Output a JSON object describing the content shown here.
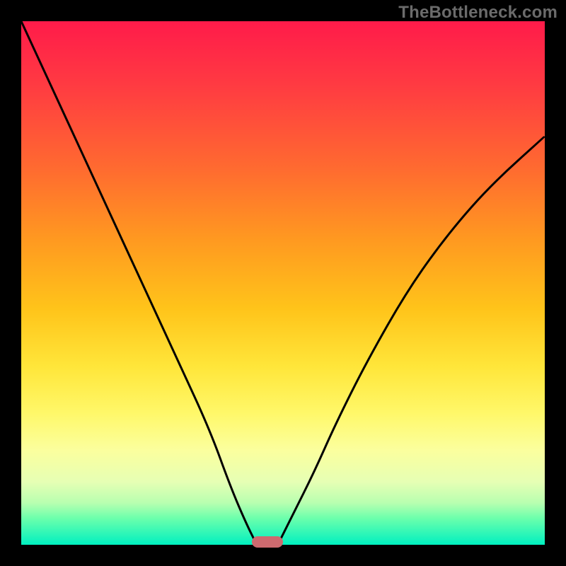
{
  "watermark": "TheBottleneck.com",
  "chart_data": {
    "type": "line",
    "title": "",
    "xlabel": "",
    "ylabel": "",
    "xlim": [
      0,
      100
    ],
    "ylim": [
      0,
      100
    ],
    "grid": false,
    "legend": false,
    "series": [
      {
        "name": "left-curve",
        "x": [
          0,
          6,
          12,
          18,
          24,
          30,
          36,
          40,
          43,
          45
        ],
        "values": [
          100,
          87,
          74,
          61,
          48,
          35,
          22,
          11,
          4,
          0
        ]
      },
      {
        "name": "right-curve",
        "x": [
          49,
          52,
          56,
          60,
          66,
          74,
          82,
          90,
          100
        ],
        "values": [
          0,
          6,
          14,
          23,
          35,
          49,
          60,
          69,
          78
        ]
      }
    ],
    "marker": {
      "x": 47,
      "y": 0,
      "color": "#cd6a6f"
    },
    "background_gradient": {
      "top": "#ff1b4a",
      "mid": "#ffe63a",
      "bottom": "#00f0c0"
    }
  },
  "colors": {
    "curve": "#000000",
    "frame_bg_border": "#000000",
    "marker": "#cd6a6f",
    "watermark": "#6b6b6b"
  }
}
